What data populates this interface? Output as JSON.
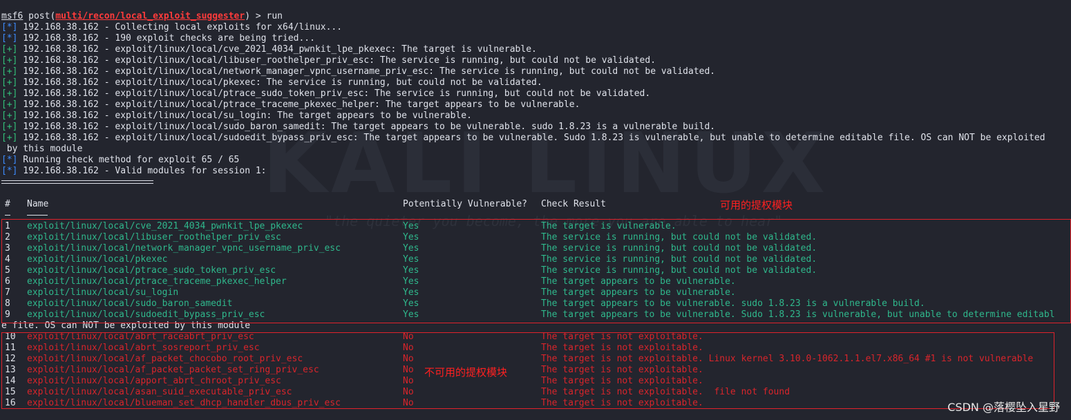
{
  "prompt": {
    "user": "msf6",
    "pre": " post(",
    "module": "multi/recon/local_exploit_suggester",
    "post": ") > run"
  },
  "log": [
    {
      "tag": "[*]",
      "kind": "info",
      "text": " 192.168.38.162 - Collecting local exploits for x64/linux..."
    },
    {
      "tag": "[*]",
      "kind": "info",
      "text": " 192.168.38.162 - 190 exploit checks are being tried..."
    },
    {
      "tag": "[+]",
      "kind": "good",
      "text": " 192.168.38.162 - exploit/linux/local/cve_2021_4034_pwnkit_lpe_pkexec: The target is vulnerable."
    },
    {
      "tag": "[+]",
      "kind": "good",
      "text": " 192.168.38.162 - exploit/linux/local/libuser_roothelper_priv_esc: The service is running, but could not be validated."
    },
    {
      "tag": "[+]",
      "kind": "good",
      "text": " 192.168.38.162 - exploit/linux/local/network_manager_vpnc_username_priv_esc: The service is running, but could not be validated."
    },
    {
      "tag": "[+]",
      "kind": "good",
      "text": " 192.168.38.162 - exploit/linux/local/pkexec: The service is running, but could not be validated."
    },
    {
      "tag": "[+]",
      "kind": "good",
      "text": " 192.168.38.162 - exploit/linux/local/ptrace_sudo_token_priv_esc: The service is running, but could not be validated."
    },
    {
      "tag": "[+]",
      "kind": "good",
      "text": " 192.168.38.162 - exploit/linux/local/ptrace_traceme_pkexec_helper: The target appears to be vulnerable."
    },
    {
      "tag": "[+]",
      "kind": "good",
      "text": " 192.168.38.162 - exploit/linux/local/su_login: The target appears to be vulnerable."
    },
    {
      "tag": "[+]",
      "kind": "good",
      "text": " 192.168.38.162 - exploit/linux/local/sudo_baron_samedit: The target appears to be vulnerable. sudo 1.8.23 is a vulnerable build."
    },
    {
      "tag": "[+]",
      "kind": "good",
      "text": " 192.168.38.162 - exploit/linux/local/sudoedit_bypass_priv_esc: The target appears to be vulnerable. Sudo 1.8.23 is vulnerable, but unable to determine editable file. OS can NOT be exploited"
    },
    {
      "tag": "",
      "kind": "plain",
      "text": " by this module"
    },
    {
      "tag": "[*]",
      "kind": "info",
      "text": " Running check method for exploit 65 / 65"
    },
    {
      "tag": "[*]",
      "kind": "info",
      "text": " 192.168.38.162 - Valid modules for session 1:"
    }
  ],
  "table": {
    "headers": {
      "num": "#",
      "name": "Name",
      "vuln": "Potentially Vulnerable?",
      "result": "Check Result"
    },
    "rows": [
      {
        "n": "1",
        "name": "exploit/linux/local/cve_2021_4034_pwnkit_lpe_pkexec",
        "v": "Yes",
        "res": "The target is vulnerable."
      },
      {
        "n": "2",
        "name": "exploit/linux/local/libuser_roothelper_priv_esc",
        "v": "Yes",
        "res": "The service is running, but could not be validated."
      },
      {
        "n": "3",
        "name": "exploit/linux/local/network_manager_vpnc_username_priv_esc",
        "v": "Yes",
        "res": "The service is running, but could not be validated."
      },
      {
        "n": "4",
        "name": "exploit/linux/local/pkexec",
        "v": "Yes",
        "res": "The service is running, but could not be validated."
      },
      {
        "n": "5",
        "name": "exploit/linux/local/ptrace_sudo_token_priv_esc",
        "v": "Yes",
        "res": "The service is running, but could not be validated."
      },
      {
        "n": "6",
        "name": "exploit/linux/local/ptrace_traceme_pkexec_helper",
        "v": "Yes",
        "res": "The target appears to be vulnerable."
      },
      {
        "n": "7",
        "name": "exploit/linux/local/su_login",
        "v": "Yes",
        "res": "The target appears to be vulnerable."
      },
      {
        "n": "8",
        "name": "exploit/linux/local/sudo_baron_samedit",
        "v": "Yes",
        "res": "The target appears to be vulnerable. sudo 1.8.23 is a vulnerable build."
      },
      {
        "n": "9",
        "name": "exploit/linux/local/sudoedit_bypass_priv_esc",
        "v": "Yes",
        "res": "The target appears to be vulnerable. Sudo 1.8.23 is vulnerable, but unable to determine editabl"
      }
    ],
    "wrap": "e file. OS can NOT be exploited by this module",
    "rows_no": [
      {
        "n": "10",
        "name": "exploit/linux/local/abrt_raceabrt_priv_esc",
        "v": "No",
        "res": "The target is not exploitable."
      },
      {
        "n": "11",
        "name": "exploit/linux/local/abrt_sosreport_priv_esc",
        "v": "No",
        "res": "The target is not exploitable."
      },
      {
        "n": "12",
        "name": "exploit/linux/local/af_packet_chocobo_root_priv_esc",
        "v": "No",
        "res": "The target is not exploitable. Linux kernel 3.10.0-1062.1.1.el7.x86_64 #1 is not vulnerable"
      },
      {
        "n": "13",
        "name": "exploit/linux/local/af_packet_packet_set_ring_priv_esc",
        "v": "No",
        "res": "The target is not exploitable."
      },
      {
        "n": "14",
        "name": "exploit/linux/local/apport_abrt_chroot_priv_esc",
        "v": "No",
        "res": "The target is not exploitable."
      },
      {
        "n": "15",
        "name": "exploit/linux/local/asan_suid_executable_priv_esc",
        "v": "No",
        "res": "The target is not exploitable.  file not found"
      },
      {
        "n": "16",
        "name": "exploit/linux/local/blueman_set_dhcp_handler_dbus_priv_esc",
        "v": "No",
        "res": "The target is not exploitable."
      }
    ]
  },
  "annotations": {
    "available": "可用的提权模块",
    "unavailable": "不可用的提权模块"
  },
  "watermark": {
    "logo": "KALI LINUX",
    "quote": "\"the quieter you become, the more you are able to hear\""
  },
  "credit": "CSDN @落樱坠入星野",
  "colors": {
    "bg": "#23252e",
    "info": "#3d8bfd",
    "good": "#33c17a",
    "yes_rows": "#2fb88c",
    "no_rows": "#d8252b",
    "annotation": "#ff2020"
  }
}
